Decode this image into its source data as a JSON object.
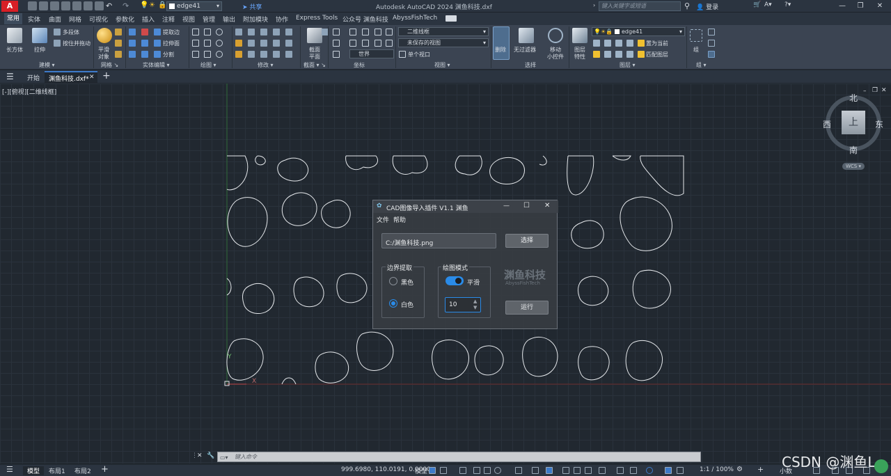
{
  "app": {
    "logo": "A",
    "title": "Autodesk AutoCAD 2024    渊鱼科技.dxf",
    "quick_layer": "edge41",
    "share": "共享",
    "search_placeholder": "键入关键字或短语",
    "login": "登录"
  },
  "menu_tabs": [
    "常用",
    "实体",
    "曲面",
    "网格",
    "可视化",
    "参数化",
    "插入",
    "注释",
    "视图",
    "管理",
    "输出",
    "附加模块",
    "协作",
    "Express Tools",
    "公众号 渊鱼科技",
    "AbyssFishTech"
  ],
  "ribbon": {
    "panels": [
      {
        "title": "建模"
      },
      {
        "title": "网格"
      },
      {
        "title": "实体编辑"
      },
      {
        "title": "绘图"
      },
      {
        "title": "修改"
      },
      {
        "title": "截面"
      },
      {
        "title": "坐标"
      },
      {
        "title": "视图"
      },
      {
        "title": "选择"
      },
      {
        "title": "图层"
      },
      {
        "title": "组"
      }
    ],
    "labels": {
      "box": "长方体",
      "extrude": "拉伸",
      "polysolid": "多段体",
      "presspull": "按住并拖动",
      "smooth": "平滑",
      "smooth2": "对象",
      "extract_edges": "提取边",
      "extrude_face": "拉伸面",
      "split": "分割",
      "section_plane": "截面",
      "section_plane2": "平面",
      "visual_style": "二维线框",
      "saved_view": "未保存的视图",
      "world": "世界",
      "single_view": "单个视口",
      "delete": "删除",
      "no_filter": "无过滤器",
      "move_gizmo": "移动",
      "move_gizmo2": "小控件",
      "layer_props": "图层",
      "layer_props2": "特性",
      "layer_name": "edge41",
      "set_current": "置为当前",
      "match_layer": "匹配图层",
      "group": "组"
    }
  },
  "doc_tabs": {
    "start": "开始",
    "current": "渊鱼科技.dxf*"
  },
  "viewport": {
    "label": "[-][俯视][二维线框]",
    "compass": {
      "north": "北",
      "south": "南",
      "east": "东",
      "west": "西",
      "top": "上"
    },
    "wcs": "WCS"
  },
  "dialog": {
    "title": "CAD图像导入插件 V1.1 渊鱼",
    "menu": [
      "文件",
      "帮助"
    ],
    "file_path": "C:/渊鱼科技.png",
    "select_button": "选择",
    "boundary_group": "边界提取",
    "radio_black": "黑色",
    "radio_white": "白色",
    "selected_radio": "白色",
    "mode_group": "绘图模式",
    "smooth_toggle_label": "平滑",
    "smooth_on": true,
    "spin_value": "10",
    "run_button": "运行",
    "watermark": "渊鱼科技",
    "watermark_sub": "AbyssFishTech"
  },
  "command_line": {
    "placeholder": "键入命令"
  },
  "status": {
    "tabs": [
      "模型",
      "布局1",
      "布局2"
    ],
    "coords": "999.6980, 110.0191, 0.0000",
    "model": "模型",
    "scale": "1:1 / 100%",
    "units": "小数"
  },
  "watermark_text": "CSDN @渊鱼L"
}
